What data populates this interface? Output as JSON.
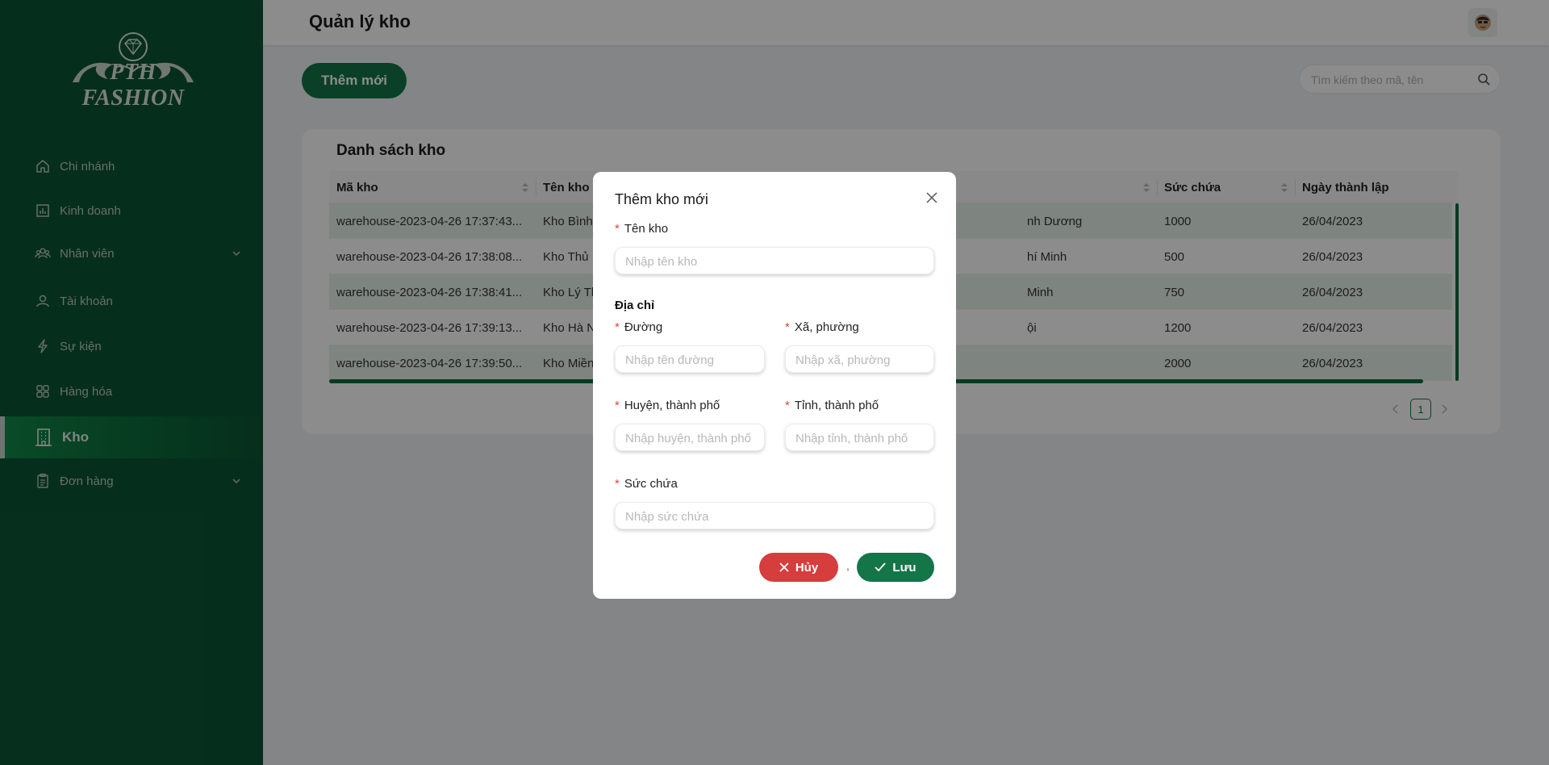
{
  "brand": {
    "logo_text": "PTH FASHION"
  },
  "sidebar": {
    "items": [
      {
        "label": "Chi nhánh",
        "icon": "home-icon",
        "has_submenu": false,
        "active": false
      },
      {
        "label": "Kinh doanh",
        "icon": "bar-chart-icon",
        "has_submenu": false,
        "active": false
      },
      {
        "label": "Nhân viên",
        "icon": "team-icon",
        "has_submenu": true,
        "active": false
      },
      {
        "label": "Tài khoản",
        "icon": "user-icon",
        "has_submenu": false,
        "active": false
      },
      {
        "label": "Sự kiện",
        "icon": "thunderbolt-icon",
        "has_submenu": false,
        "active": false
      },
      {
        "label": "Hàng hóa",
        "icon": "grid-icon",
        "has_submenu": false,
        "active": false
      },
      {
        "label": "Kho",
        "icon": "building-icon",
        "has_submenu": false,
        "active": true
      },
      {
        "label": "Đơn hàng",
        "icon": "clipboard-icon",
        "has_submenu": true,
        "active": false
      }
    ]
  },
  "header": {
    "title": "Quản lý kho",
    "avatar_icon": "avatar-icon"
  },
  "toolbar": {
    "add_label": "Thêm mới",
    "search_placeholder": "Tìm kiếm theo mã, tên",
    "search_icon": "search-icon"
  },
  "warehouse_list": {
    "title": "Danh sách kho",
    "columns": [
      "Mã kho",
      "Tên kho",
      "",
      "Sức chứa",
      "Ngày thành lập"
    ],
    "rows": [
      {
        "code": "warehouse-2023-04-26 17:37:43...",
        "name": "Kho Bình",
        "address": "nh Dương",
        "capacity": "1000",
        "date": "26/04/2023"
      },
      {
        "code": "warehouse-2023-04-26 17:38:08...",
        "name": "Kho Thủ",
        "address": "hí Minh",
        "capacity": "500",
        "date": "26/04/2023"
      },
      {
        "code": "warehouse-2023-04-26 17:38:41...",
        "name": "Kho Lý Th",
        "address": "Minh",
        "capacity": "750",
        "date": "26/04/2023"
      },
      {
        "code": "warehouse-2023-04-26 17:39:13...",
        "name": "Kho Hà N",
        "address": "ội",
        "capacity": "1200",
        "date": "26/04/2023"
      },
      {
        "code": "warehouse-2023-04-26 17:39:50...",
        "name": "Kho Miền",
        "address": "",
        "capacity": "2000",
        "date": "26/04/2023"
      }
    ],
    "pagination": {
      "current_page": "1"
    }
  },
  "modal": {
    "title": "Thêm kho mới",
    "fields": {
      "name": {
        "label": "Tên kho",
        "placeholder": "Nhập tên kho",
        "value": ""
      },
      "street": {
        "label": "Đường",
        "placeholder": "Nhập tên đường",
        "value": ""
      },
      "ward": {
        "label": "Xã, phường",
        "placeholder": "Nhập xã, phường",
        "value": ""
      },
      "district": {
        "label": "Huyện, thành phố",
        "placeholder": "Nhập huyện, thành phố",
        "value": ""
      },
      "province": {
        "label": "Tỉnh, thành phố",
        "placeholder": "Nhập tỉnh, thành phố",
        "value": ""
      },
      "capacity": {
        "label": "Sức chứa",
        "placeholder": "Nhập sức chứa",
        "value": ""
      }
    },
    "address_section": "Địa chỉ",
    "required_mark": "*",
    "separator": ",",
    "cancel_label": "Hủy",
    "save_label": "Lưu"
  },
  "colors": {
    "sidebar_bg": "#0b5534",
    "accent": "#137548",
    "danger": "#d63d3d",
    "row_alt": "#e6f1ea"
  }
}
